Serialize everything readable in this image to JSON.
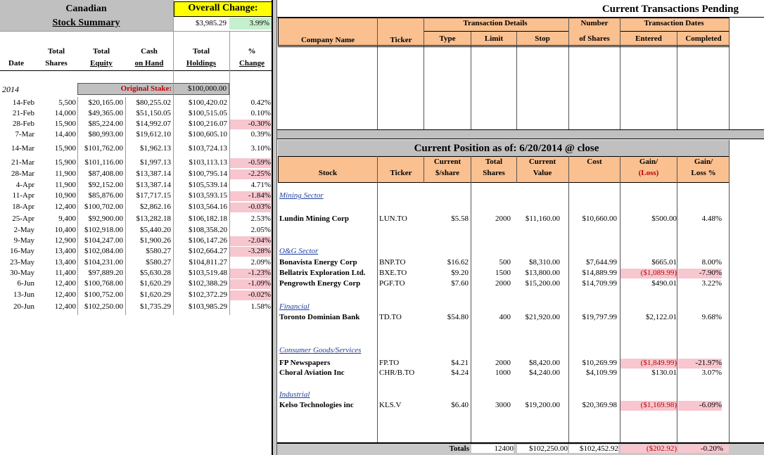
{
  "summary": {
    "title_line1": "Canadian",
    "title_line2": "Stock Summary",
    "overall_change_label": "Overall Change:",
    "overall_change_amount": "$3,985.29",
    "overall_change_pct": "3.99%",
    "headers": {
      "date": "Date",
      "total_shares_1": "Total",
      "total_shares_2": "Shares",
      "total_equity_1": "Total",
      "total_equity_2": "Equity",
      "cash_1": "Cash",
      "cash_2": "on Hand",
      "holdings_1": "Total",
      "holdings_2": "Holdings",
      "pct_1": "%",
      "pct_2": "Change"
    },
    "year": "2014",
    "original_stake_label": "Original Stake:",
    "original_stake_value": "$100,000.00",
    "rows": [
      {
        "date": "14-Feb",
        "shares": "5,500",
        "equity": "$20,165.00",
        "cash": "$80,255.02",
        "holdings": "$100,420.02",
        "pct": "0.42%",
        "neg": false
      },
      {
        "date": "21-Feb",
        "shares": "14,000",
        "equity": "$49,365.00",
        "cash": "$51,150.05",
        "holdings": "$100,515.05",
        "pct": "0.10%",
        "neg": false
      },
      {
        "date": "28-Feb",
        "shares": "15,900",
        "equity": "$85,224.00",
        "cash": "$14,992.07",
        "holdings": "$100,216.07",
        "pct": "-0.30%",
        "neg": true
      },
      {
        "date": "7-Mar",
        "shares": "14,400",
        "equity": "$80,993.00",
        "cash": "$19,612.10",
        "holdings": "$100,605.10",
        "pct": "0.39%",
        "neg": false
      },
      {
        "date": "14-Mar",
        "shares": "15,900",
        "equity": "$101,762.00",
        "cash": "$1,962.13",
        "holdings": "$103,724.13",
        "pct": "3.10%",
        "neg": false
      },
      {
        "date": "21-Mar",
        "shares": "15,900",
        "equity": "$101,116.00",
        "cash": "$1,997.13",
        "holdings": "$103,113.13",
        "pct": "-0.59%",
        "neg": true
      },
      {
        "date": "28-Mar",
        "shares": "11,900",
        "equity": "$87,408.00",
        "cash": "$13,387.14",
        "holdings": "$100,795.14",
        "pct": "-2.25%",
        "neg": true
      },
      {
        "date": "4-Apr",
        "shares": "11,900",
        "equity": "$92,152.00",
        "cash": "$13,387.14",
        "holdings": "$105,539.14",
        "pct": "4.71%",
        "neg": false
      },
      {
        "date": "11-Apr",
        "shares": "10,900",
        "equity": "$85,876.00",
        "cash": "$17,717.15",
        "holdings": "$103,593.15",
        "pct": "-1.84%",
        "neg": true
      },
      {
        "date": "18-Apr",
        "shares": "12,400",
        "equity": "$100,702.00",
        "cash": "$2,862.16",
        "holdings": "$103,564.16",
        "pct": "-0.03%",
        "neg": true
      },
      {
        "date": "25-Apr",
        "shares": "9,400",
        "equity": "$92,900.00",
        "cash": "$13,282.18",
        "holdings": "$106,182.18",
        "pct": "2.53%",
        "neg": false
      },
      {
        "date": "2-May",
        "shares": "10,400",
        "equity": "$102,918.00",
        "cash": "$5,440.20",
        "holdings": "$108,358.20",
        "pct": "2.05%",
        "neg": false
      },
      {
        "date": "9-May",
        "shares": "12,900",
        "equity": "$104,247.00",
        "cash": "$1,900.26",
        "holdings": "$106,147.26",
        "pct": "-2.04%",
        "neg": true
      },
      {
        "date": "16-May",
        "shares": "13,400",
        "equity": "$102,084.00",
        "cash": "$580.27",
        "holdings": "$102,664.27",
        "pct": "-3.28%",
        "neg": true
      },
      {
        "date": "23-May",
        "shares": "13,400",
        "equity": "$104,231.00",
        "cash": "$580.27",
        "holdings": "$104,811.27",
        "pct": "2.09%",
        "neg": false
      },
      {
        "date": "30-May",
        "shares": "11,400",
        "equity": "$97,889.20",
        "cash": "$5,630.28",
        "holdings": "$103,519.48",
        "pct": "-1.23%",
        "neg": true
      },
      {
        "date": "6-Jun",
        "shares": "12,400",
        "equity": "$100,768.00",
        "cash": "$1,620.29",
        "holdings": "$102,388.29",
        "pct": "-1.09%",
        "neg": true
      },
      {
        "date": "13-Jun",
        "shares": "12,400",
        "equity": "$100,752.00",
        "cash": "$1,620.29",
        "holdings": "$102,372.29",
        "pct": "-0.02%",
        "neg": true
      },
      {
        "date": "20-Jun",
        "shares": "12,400",
        "equity": "$102,250.00",
        "cash": "$1,735.29",
        "holdings": "$103,985.29",
        "pct": "1.58%",
        "neg": false
      }
    ]
  },
  "pending": {
    "title": "Current Transactions Pending",
    "group_details": "Transaction Details",
    "group_dates": "Transaction Dates",
    "number_1": "Number",
    "number_2": "of Shares",
    "company": "Company Name",
    "ticker": "Ticker",
    "type": "Type",
    "limit": "Limit",
    "stop": "Stop",
    "entered": "Entered",
    "completed": "Completed"
  },
  "position": {
    "title": "Current Position as of: 6/20/2014  @ close",
    "headers": {
      "stock": "Stock",
      "ticker": "Ticker",
      "price_1": "Current",
      "price_2": "$/share",
      "shares_1": "Total",
      "shares_2": "Shares",
      "value_1": "Current",
      "value_2": "Value",
      "cost": "Cost",
      "gain_1": "Gain/",
      "gain_2": "(Loss)",
      "gainpct_1": "Gain/",
      "gainpct_2": "Loss %"
    },
    "sectors": [
      {
        "name": "Mining Sector",
        "stocks": [
          {
            "stock": "Lundin Mining Corp",
            "ticker": "LUN.TO",
            "price": "$5.58",
            "shares": "2000",
            "value": "$11,160.00",
            "cost": "$10,660.00",
            "gain": "$500.00",
            "gainpct": "4.48%",
            "neg": false
          }
        ]
      },
      {
        "name": "O&G Sector",
        "stocks": [
          {
            "stock": "Bonavista Energy Corp",
            "ticker": "BNP.TO",
            "price": "$16.62",
            "shares": "500",
            "value": "$8,310.00",
            "cost": "$7,644.99",
            "gain": "$665.01",
            "gainpct": "8.00%",
            "neg": false
          },
          {
            "stock": "Bellatrix Exploration Ltd.",
            "ticker": "BXE.TO",
            "price": "$9.20",
            "shares": "1500",
            "value": "$13,800.00",
            "cost": "$14,889.99",
            "gain": "($1,089.99)",
            "gainpct": "-7.90%",
            "neg": true
          },
          {
            "stock": "Pengrowth Energy Corp",
            "ticker": "PGF.TO",
            "price": "$7.60",
            "shares": "2000",
            "value": "$15,200.00",
            "cost": "$14,709.99",
            "gain": "$490.01",
            "gainpct": "3.22%",
            "neg": false
          }
        ]
      },
      {
        "name": "Financial",
        "stocks": [
          {
            "stock": "Toronto Dominian Bank",
            "ticker": "TD.TO",
            "price": "$54.80",
            "shares": "400",
            "value": "$21,920.00",
            "cost": "$19,797.99",
            "gain": "$2,122.01",
            "gainpct": "9.68%",
            "neg": false
          }
        ]
      },
      {
        "name": "Consumer Goods/Services",
        "stocks": [
          {
            "stock": "FP Newspapers",
            "ticker": "FP.TO",
            "price": "$4.21",
            "shares": "2000",
            "value": "$8,420.00",
            "cost": "$10,269.99",
            "gain": "($1,849.99)",
            "gainpct": "-21.97%",
            "neg": true
          },
          {
            "stock": "Choral Aviation Inc",
            "ticker": "CHR/B.TO",
            "price": "$4.24",
            "shares": "1000",
            "value": "$4,240.00",
            "cost": "$4,109.99",
            "gain": "$130.01",
            "gainpct": "3.07%",
            "neg": false
          }
        ]
      },
      {
        "name": "Industrial",
        "stocks": [
          {
            "stock": "Kelso Technologies inc",
            "ticker": "KLS.V",
            "price": "$6.40",
            "shares": "3000",
            "value": "$19,200.00",
            "cost": "$20,369.98",
            "gain": "($1,169.98)",
            "gainpct": "-6.09%",
            "neg": true
          }
        ]
      }
    ],
    "totals": {
      "label": "Totals",
      "shares": "12400",
      "value": "$102,250.00",
      "cost": "$102,452.92",
      "gain": "($202.92)",
      "gainpct": "-0.20%"
    }
  },
  "colors": {
    "header_fill": "#fac090",
    "overall_fill": "#ffff00",
    "positive_pct_fill": "#c6efce",
    "negative_fill": "#f7c6ce",
    "negative_text": "#c00000",
    "sector_text": "#1f3f9f",
    "stake_label": "#c00000"
  }
}
